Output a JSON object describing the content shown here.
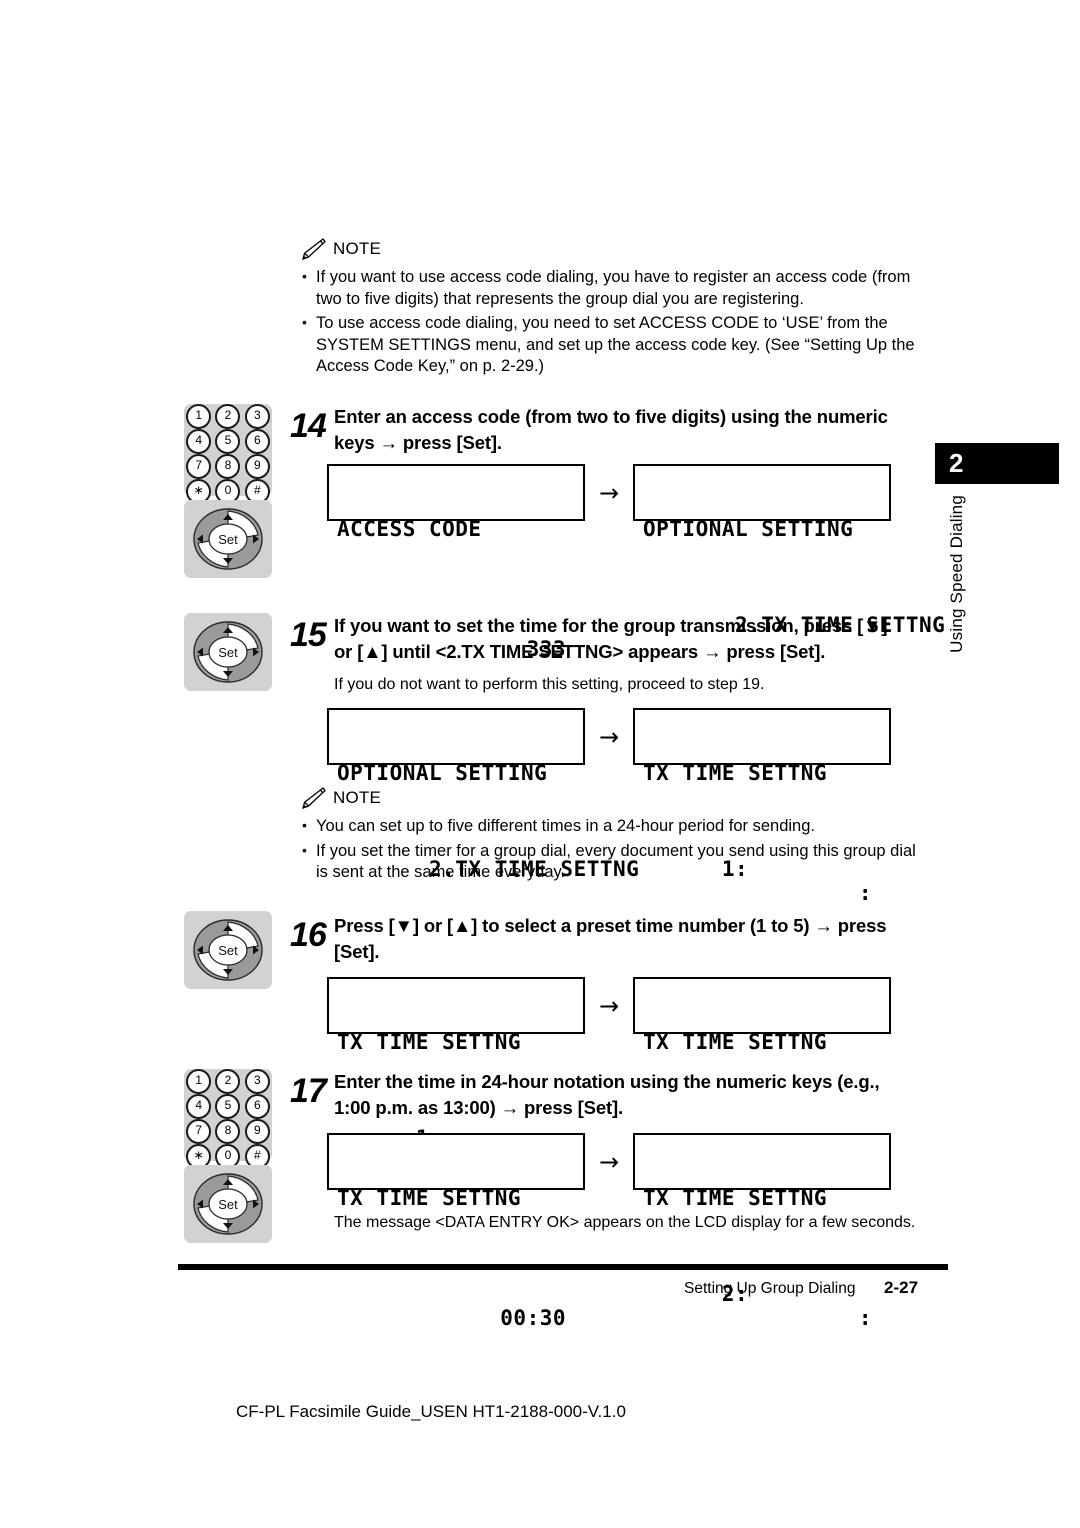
{
  "notes": [
    {
      "label": "NOTE",
      "items": [
        "If you want to use access code dialing, you have to register an access code (from two to five digits) that represents the group dial you are registering.",
        "To use access code dialing, you need to set ACCESS CODE to ‘USE’ from the SYSTEM SETTINGS menu, and set up the access code key. (See “Setting Up the Access Code Key,” on p. 2-29.)"
      ]
    },
    {
      "label": "NOTE",
      "items": [
        "You can set up to five different times in a 24-hour period for sending.",
        "If you set the timer for a group dial, every document you send using this group dial is sent at the same time everyday."
      ]
    }
  ],
  "steps": [
    {
      "number": "14",
      "text": "Enter an access code (from two to five digits) using the numeric keys → press [Set].",
      "icons": [
        "numeric-keypad",
        "set-navpad"
      ],
      "lcd": {
        "left": {
          "line1": "ACCESS CODE",
          "line2": "",
          "line2_right": "333"
        },
        "arrow": "→",
        "right": {
          "line1": "OPTIONAL SETTING",
          "line2": " 2.TX TIME SETTNG",
          "line2_right": ""
        }
      }
    },
    {
      "number": "15",
      "text": "If you want to set the time for the group transmission, press [▼] or [▲] until <2.TX TIME SETTNG> appears → press [Set].",
      "sub": "If you do not want to perform this setting, proceed to step 19.",
      "icons": [
        "set-navpad"
      ],
      "lcd": {
        "left": {
          "line1": "OPTIONAL SETTING",
          "line2": " 2.TX TIME SETTNG",
          "line2_right": ""
        },
        "arrow": "→",
        "right": {
          "line1": "TX TIME SETTNG",
          "line2": "1:",
          "line2_right": ":"
        }
      }
    },
    {
      "number": "16",
      "text": "Press [▼] or [▲] to select a preset time number (1 to 5) → press [Set].",
      "icons": [
        "set-navpad"
      ],
      "lcd": {
        "left": {
          "line1": "TX TIME SETTNG",
          "line2": "1:",
          "line2_right": ":"
        },
        "arrow": "→",
        "right": {
          "line1": "TX TIME SETTNG",
          "line2": "",
          "line2_right": "_ :"
        }
      }
    },
    {
      "number": "17",
      "text": "Enter the time in 24-hour notation using the numeric keys (e.g., 1:00 p.m. as 13:00) → press [Set].",
      "icons": [
        "numeric-keypad",
        "set-navpad"
      ],
      "lcd": {
        "left": {
          "line1": "TX TIME SETTNG",
          "line2": "",
          "line2_right": "00:30"
        },
        "arrow": "→",
        "right": {
          "line1": "TX TIME SETTNG",
          "line2": "2:",
          "line2_right": ":"
        }
      },
      "foot": "The message <DATA ENTRY OK> appears on the LCD display for a few seconds."
    }
  ],
  "keypad_keys": [
    "1",
    "2",
    "3",
    "4",
    "5",
    "6",
    "7",
    "8",
    "9",
    "∗",
    "0",
    "#"
  ],
  "navpad_label": "Set",
  "chapter_tab": {
    "number": "2",
    "title": "Using Speed Dialing"
  },
  "footer": {
    "title": "Setting Up Group Dialing",
    "page": "2-27"
  },
  "caption": "CF-PL Facsimile Guide_USEN HT1-2188-000-V.1.0",
  "colors": {
    "ink": "#000000",
    "panel": "#d2d2d2",
    "page": "#ffffff"
  }
}
